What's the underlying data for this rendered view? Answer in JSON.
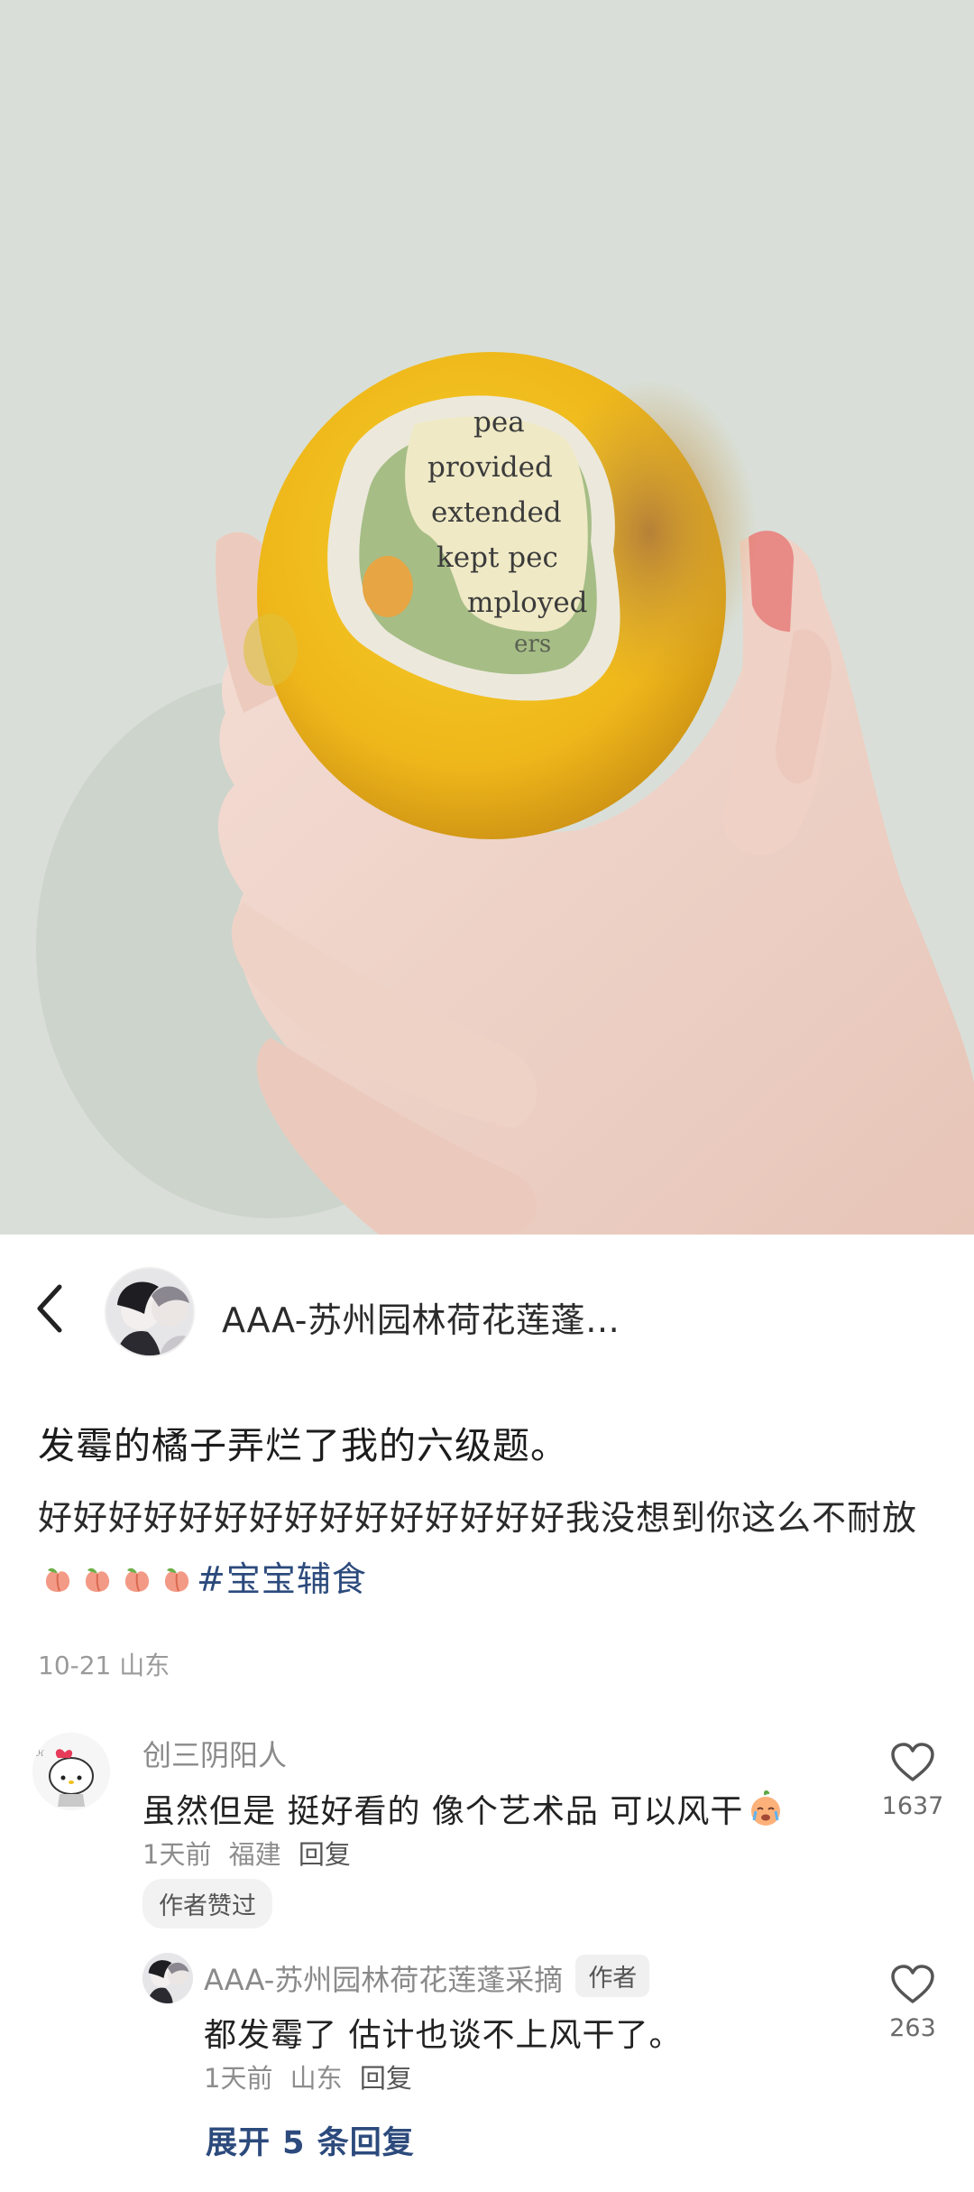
{
  "post": {
    "author_name": "AAA-苏州园林荷花莲蓬…",
    "title": "发霉的橘子弄烂了我的六级题。",
    "body_text": "好好好好好好好好好好好好好好好我没想到你这么不耐放",
    "hashtag": "#宝宝辅食",
    "date": "10-21",
    "location": "山东",
    "photo_words": [
      "pea",
      "provided",
      "extended",
      "kept pec",
      "mployed",
      "ers"
    ]
  },
  "comments": [
    {
      "user": "创三阴阳人",
      "text": "虽然但是 挺好看的 像个艺术品 可以风干",
      "time": "1天前",
      "location": "福建",
      "reply_label": "回复",
      "chip": "作者赞过",
      "likes": "1637",
      "replies": [
        {
          "user": "AAA-苏州园林荷花莲蓬采摘",
          "badge": "作者",
          "text": "都发霉了 估计也谈不上风干了。",
          "time": "1天前",
          "location": "山东",
          "reply_label": "回复",
          "likes": "263"
        }
      ]
    }
  ],
  "expand_label": "展开 5 条回复",
  "colors": {
    "hashtag": "#2c4a7c",
    "expand": "#2c4a7c",
    "orange": "#f2b81c",
    "mold_green": "#a6bd86",
    "background": "#ffffff"
  },
  "icons": [
    "back-arrow-icon",
    "heart-icon",
    "peach-emoji-icon",
    "crying-emoji-icon"
  ]
}
